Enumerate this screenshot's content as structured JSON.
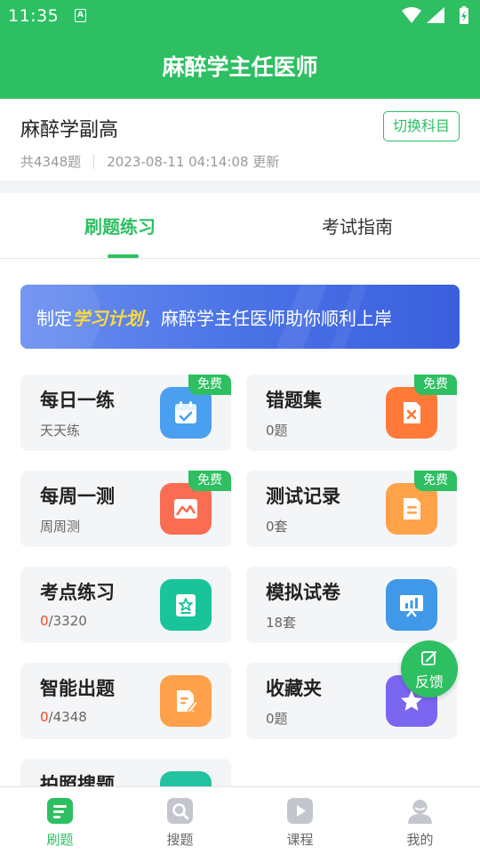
{
  "status_bar": {
    "time": "11:35",
    "notification_icon": "a-icon",
    "indicators": [
      "wifi-icon",
      "signal-icon",
      "battery-charging-icon"
    ]
  },
  "app_bar": {
    "title": "麻醉学主任医师"
  },
  "subject": {
    "name": "麻醉学副高",
    "question_count": "共4348题",
    "updated": "2023-08-11 04:14:08 更新",
    "switch_label": "切换科目"
  },
  "tabs": [
    {
      "label": "刷题练习",
      "active": true
    },
    {
      "label": "考试指南",
      "active": false
    }
  ],
  "banner": {
    "prefix": "制定",
    "highlight": "学习计划",
    "suffix": "，麻醉学主任医师助你顺利上岸"
  },
  "cards": [
    {
      "title": "每日一练",
      "sub": "天天练",
      "free": "免费",
      "icon": "calendar-icon",
      "color": "#4a9ff0"
    },
    {
      "title": "错题集",
      "sub": "0题",
      "free": "免费",
      "icon": "wrong-doc-icon",
      "color": "#ff7a38"
    },
    {
      "title": "每周一测",
      "sub": "周周测",
      "free": "免费",
      "icon": "image-chart-icon",
      "color": "#fb6d52"
    },
    {
      "title": "测试记录",
      "sub": "0套",
      "free": "免费",
      "icon": "document-icon",
      "color": "#ffa24a"
    },
    {
      "title": "考点练习",
      "sub_done": "0",
      "sub_total": "/3320",
      "icon": "star-book-icon",
      "color": "#19c49a"
    },
    {
      "title": "模拟试卷",
      "sub": "18套",
      "icon": "presentation-chart-icon",
      "color": "#3f99e8"
    },
    {
      "title": "智能出题",
      "sub_done": "0",
      "sub_total": "/4348",
      "icon": "edit-doc-icon",
      "color": "#ffa04a"
    },
    {
      "title": "收藏夹",
      "sub": "0题",
      "icon": "star-icon",
      "color": "#7b66f2"
    },
    {
      "title": "拍照搜题",
      "icon": "camera-search-icon",
      "color": "#23c2a0"
    }
  ],
  "feedback": {
    "label": "反馈",
    "icon": "edit-icon"
  },
  "bottom_nav": [
    {
      "label": "刷题",
      "icon": "practice-icon",
      "active": true
    },
    {
      "label": "搜题",
      "icon": "search-icon",
      "active": false
    },
    {
      "label": "课程",
      "icon": "play-icon",
      "active": false
    },
    {
      "label": "我的",
      "icon": "profile-icon",
      "active": false
    }
  ],
  "colors": {
    "brand_green": "#2dbf62",
    "highlight_red": "#f04a1e",
    "banner_highlight": "#ffd93b"
  }
}
